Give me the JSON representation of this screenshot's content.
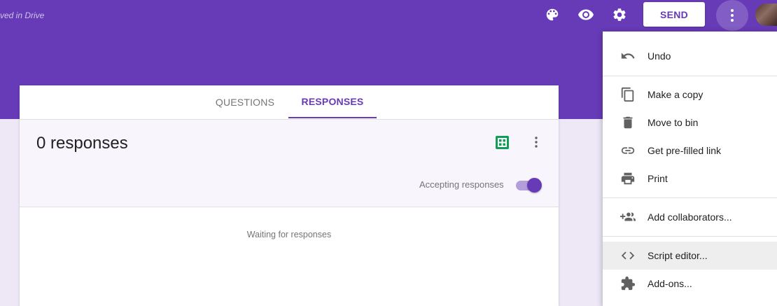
{
  "header": {
    "saved_text": "ved in Drive",
    "send_label": "SEND",
    "icons": [
      "palette-icon",
      "eye-icon",
      "gear-icon",
      "more-vert-icon"
    ],
    "brand_color": "#673ab7"
  },
  "tabs": [
    {
      "label": "QUESTIONS",
      "active": false
    },
    {
      "label": "RESPONSES",
      "active": true
    }
  ],
  "summary": {
    "count_text": "0 responses",
    "accepting_label": "Accepting responses",
    "accepting_on": true
  },
  "waiting_text": "Waiting for responses",
  "menu": {
    "items": [
      {
        "label": "Undo",
        "icon": "undo-icon"
      },
      {
        "label": "Make a copy",
        "icon": "copy-icon"
      },
      {
        "label": "Move to bin",
        "icon": "trash-icon"
      },
      {
        "label": "Get pre-filled link",
        "icon": "link-icon"
      },
      {
        "label": "Print",
        "icon": "print-icon"
      },
      {
        "label": "Add collaborators...",
        "icon": "add-people-icon"
      },
      {
        "label": "Script editor...",
        "icon": "code-icon",
        "highlighted": true
      },
      {
        "label": "Add-ons...",
        "icon": "puzzle-icon"
      }
    ]
  }
}
